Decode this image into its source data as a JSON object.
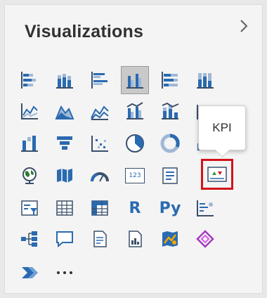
{
  "pane": {
    "title": "Visualizations",
    "collapse_icon": "chevron-right-icon"
  },
  "tooltip": {
    "text": "KPI"
  },
  "visuals": [
    [
      "stacked-bar-chart-icon",
      "stacked-column-chart-icon",
      "clustered-bar-chart-icon",
      "clustered-column-chart-icon",
      "100-stacked-bar-chart-icon",
      "100-stacked-column-chart-icon"
    ],
    [
      "line-chart-icon",
      "area-chart-icon",
      "stacked-area-chart-icon",
      "line-clustered-column-chart-icon",
      "line-stacked-column-chart-icon",
      "ribbon-chart-icon"
    ],
    [
      "waterfall-chart-icon",
      "funnel-chart-icon",
      "scatter-chart-icon",
      "pie-chart-icon",
      "donut-chart-icon",
      "treemap-icon"
    ],
    [
      "map-icon",
      "filled-map-icon",
      "gauge-icon",
      "card-icon",
      "multi-row-card-icon",
      "kpi-icon"
    ],
    [
      "slicer-icon",
      "table-icon",
      "matrix-icon",
      "r-script-visual-icon",
      "python-visual-icon",
      "key-influencers-icon"
    ],
    [
      "decomposition-tree-icon",
      "qna-icon",
      "smart-narrative-icon",
      "paginated-report-icon",
      "azure-map-icon",
      "power-apps-icon"
    ],
    [
      "power-automate-icon",
      "more-visuals-icon"
    ]
  ],
  "text_icons": {
    "card": "123",
    "r": "R",
    "py": "Py"
  },
  "colors": {
    "icon_blue": "#2a6ab0",
    "icon_dark": "#3a4f6a",
    "highlight_red": "#d3131a",
    "selected_bg": "#c9c9c9"
  }
}
